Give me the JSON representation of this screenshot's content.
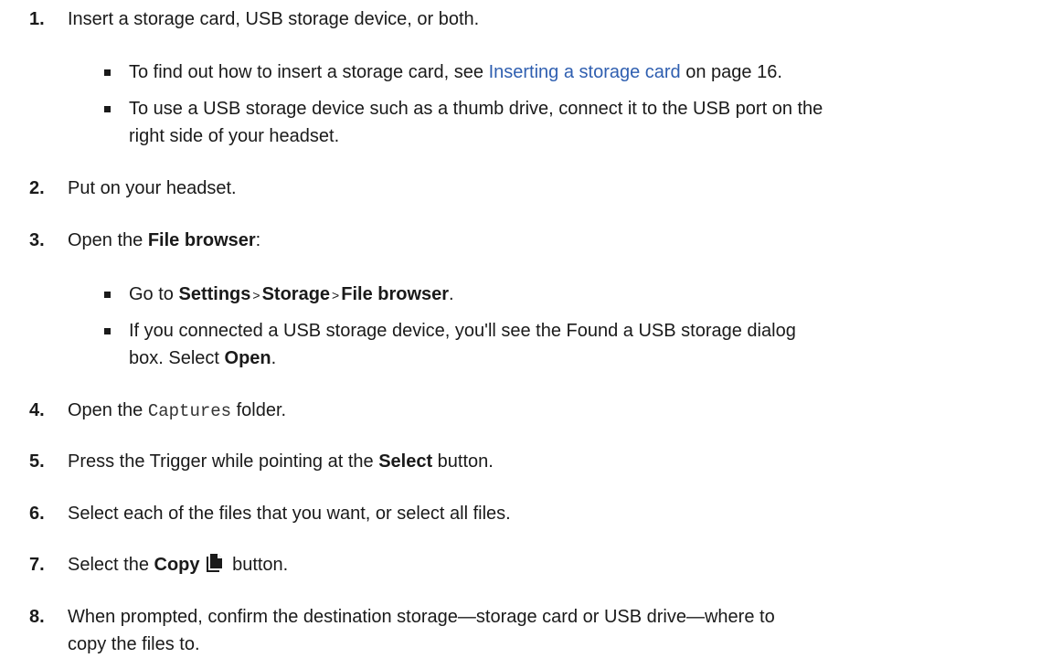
{
  "steps": [
    {
      "num": "1.",
      "text": "Insert a storage card, USB storage device, or both."
    },
    {
      "num": "2.",
      "text": "Put on your headset."
    },
    {
      "num": "3.",
      "pre": "Open the ",
      "bold": "File browser",
      "post": ":"
    },
    {
      "num": "4.",
      "pre": "Open the ",
      "mono": "Captures",
      "post": " folder."
    },
    {
      "num": "5.",
      "pre": "Press the Trigger while pointing at the ",
      "bold": "Select",
      "post": " button."
    },
    {
      "num": "6.",
      "text": "Select each of the files that you want, or select all files."
    },
    {
      "num": "7.",
      "pre": "Select the ",
      "bold": "Copy",
      "post": " button.",
      "icon": "file-copy-icon"
    },
    {
      "num": "8.",
      "line1": "When prompted, confirm the destination storage—storage card or USB drive—where to",
      "line2": "copy the files to."
    }
  ],
  "step1_bullets": [
    {
      "pre": "To find out how to insert a storage card, see ",
      "link": "Inserting a storage card",
      "post": " on page 16."
    },
    {
      "line1": "To use a USB storage device such as a thumb drive, connect it to the USB port on the",
      "line2": "right side of your headset."
    }
  ],
  "step3_bullets": [
    {
      "pre": "Go to ",
      "b1": "Settings",
      "sep1": ">",
      "b2": "Storage",
      "sep2": ">",
      "b3": "File browser",
      "post": "."
    },
    {
      "line1": "If you connected a USB storage device, you'll see the Found a USB storage dialog",
      "line2_pre": "box. Select ",
      "line2_bold": "Open",
      "line2_post": "."
    }
  ],
  "colors": {
    "link": "#2f5fb0",
    "text": "#1a1a1a"
  }
}
